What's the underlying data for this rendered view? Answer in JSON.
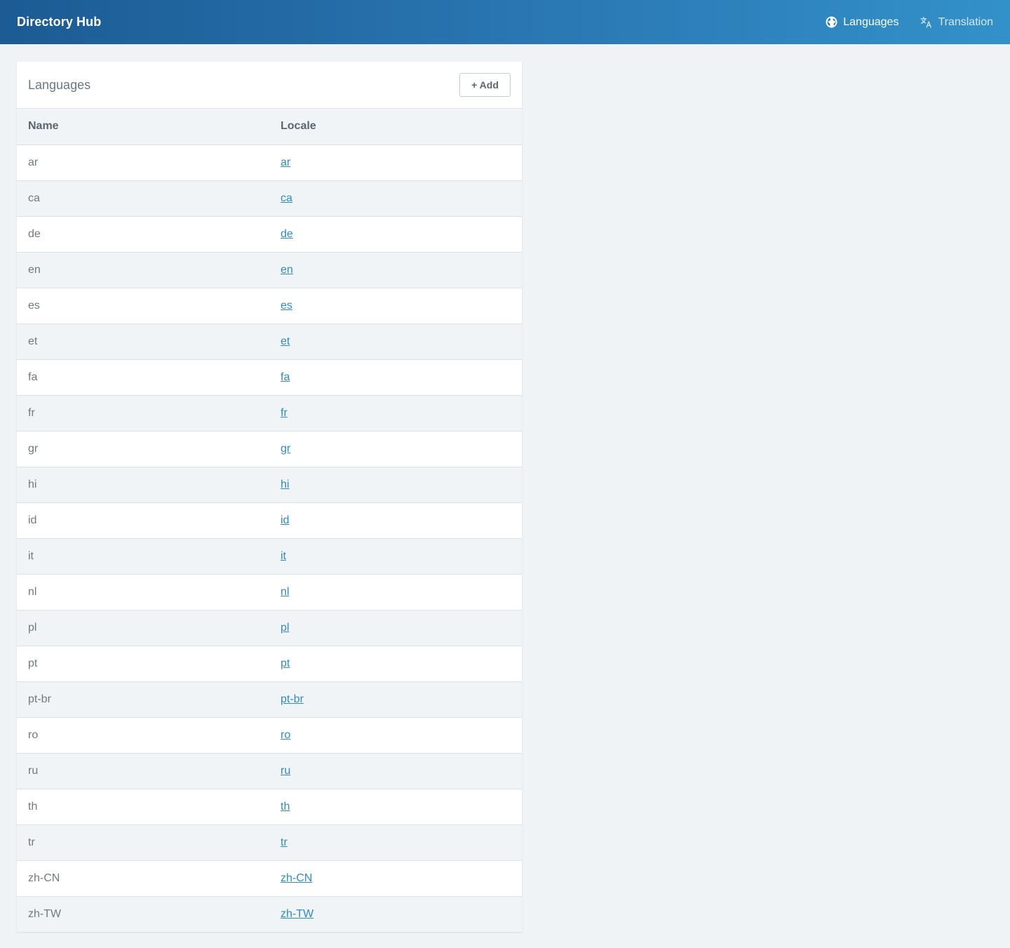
{
  "header": {
    "brand": "Directory Hub",
    "nav": [
      {
        "label": "Languages",
        "icon": "globe-icon"
      },
      {
        "label": "Translation",
        "icon": "translate-icon"
      }
    ]
  },
  "panel": {
    "title": "Languages",
    "add_label": "+ Add",
    "columns": [
      "Name",
      "Locale"
    ],
    "rows": [
      {
        "name": "ar",
        "locale": "ar"
      },
      {
        "name": "ca",
        "locale": "ca"
      },
      {
        "name": "de",
        "locale": "de"
      },
      {
        "name": "en",
        "locale": "en"
      },
      {
        "name": "es",
        "locale": "es"
      },
      {
        "name": "et",
        "locale": "et"
      },
      {
        "name": "fa",
        "locale": "fa"
      },
      {
        "name": "fr",
        "locale": "fr"
      },
      {
        "name": "gr",
        "locale": "gr"
      },
      {
        "name": "hi",
        "locale": "hi"
      },
      {
        "name": "id",
        "locale": "id"
      },
      {
        "name": "it",
        "locale": "it"
      },
      {
        "name": "nl",
        "locale": "nl"
      },
      {
        "name": "pl",
        "locale": "pl"
      },
      {
        "name": "pt",
        "locale": "pt"
      },
      {
        "name": "pt-br",
        "locale": "pt-br"
      },
      {
        "name": "ro",
        "locale": "ro"
      },
      {
        "name": "ru",
        "locale": "ru"
      },
      {
        "name": "th",
        "locale": "th"
      },
      {
        "name": "tr",
        "locale": "tr"
      },
      {
        "name": "zh-CN",
        "locale": "zh-CN"
      },
      {
        "name": "zh-TW",
        "locale": "zh-TW"
      }
    ]
  },
  "colors": {
    "header_gradient_start": "#1c5b94",
    "header_gradient_end": "#3391c9",
    "link": "#2e8cc3",
    "page_background": "#eff3f6"
  }
}
